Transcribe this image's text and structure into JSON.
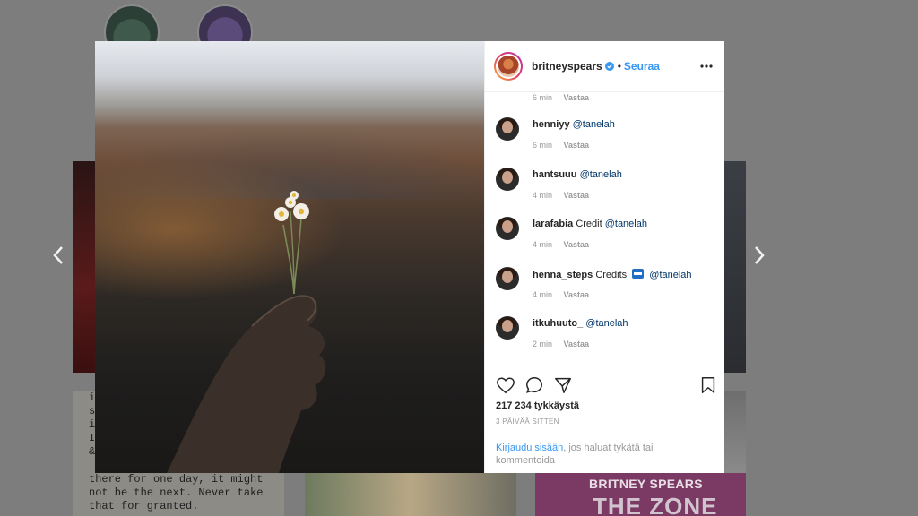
{
  "background": {
    "text_fragments": [
      "i",
      "s",
      "i",
      "",
      "I",
      "&",
      "i"
    ],
    "quote": "there for one day, it might not be the next. Never take that for granted.",
    "zone_tile": {
      "title": "BRITNEY SPEARS",
      "subtitle": "THE ZONE"
    }
  },
  "nav": {
    "prev_icon": "chevron-left-icon",
    "next_icon": "chevron-right-icon"
  },
  "post": {
    "username": "britneyspears",
    "separator": "•",
    "follow_label": "Seuraa",
    "more_icon": "more-horizontal-icon"
  },
  "comments": {
    "top_meta_time": "6 min",
    "top_meta_reply": "Vastaa",
    "items": [
      {
        "user": "henniyy",
        "text_before": "",
        "mention": "@tanelah",
        "time": "6 min",
        "reply": "Vastaa"
      },
      {
        "user": "hantsuuu",
        "text_before": "",
        "mention": "@tanelah",
        "time": "4 min",
        "reply": "Vastaa"
      },
      {
        "user": "larafabia",
        "text_before": "Credit",
        "mention": "@tanelah",
        "time": "4 min",
        "reply": "Vastaa"
      },
      {
        "user": "henna_steps",
        "text_before": "Credits",
        "mention": "@tanelah",
        "time": "4 min",
        "reply": "Vastaa"
      },
      {
        "user": "itkuhuuto_",
        "text_before": "",
        "mention": "@tanelah",
        "time": "2 min",
        "reply": "Vastaa"
      }
    ]
  },
  "actions": {
    "likes": "217 234 tykkäystä",
    "timestamp": "3 PÄIVÄÄ SITTEN",
    "login_link": "Kirjaudu sisään",
    "login_rest": ", jos haluat tykätä tai kommentoida"
  },
  "colors": {
    "link": "#3897f0",
    "mention": "#003569",
    "muted": "#999999",
    "text": "#262626"
  }
}
